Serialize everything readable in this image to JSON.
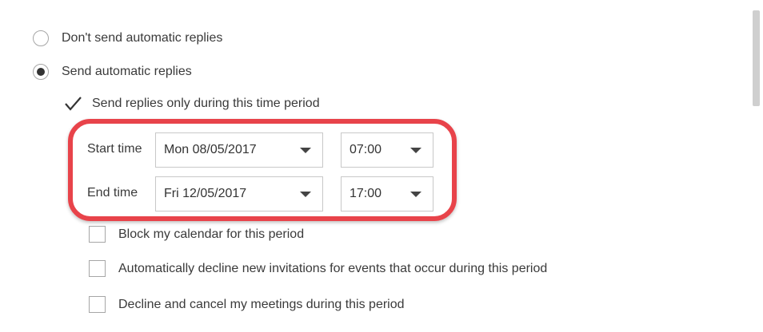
{
  "replies": {
    "dont_send_label": "Don't send automatic replies",
    "send_label": "Send automatic replies",
    "time_period_label": "Send replies only during this time period",
    "start_time_label": "Start time",
    "start_date": "Mon 08/05/2017",
    "start_hour": "07:00",
    "end_time_label": "End time",
    "end_date": "Fri 12/05/2017",
    "end_hour": "17:00",
    "block_calendar_label": "Block my calendar for this period",
    "decline_invites_label": "Automatically decline new invitations for events that occur during this period",
    "decline_cancel_label": "Decline and cancel my meetings during this period"
  },
  "state": {
    "selected_option": "send",
    "time_period_checked": true,
    "block_calendar_checked": false,
    "decline_invites_checked": false,
    "decline_cancel_checked": false
  },
  "colors": {
    "highlight": "#e8434a",
    "text": "#3a3a3a",
    "border": "#a6a6a6"
  }
}
